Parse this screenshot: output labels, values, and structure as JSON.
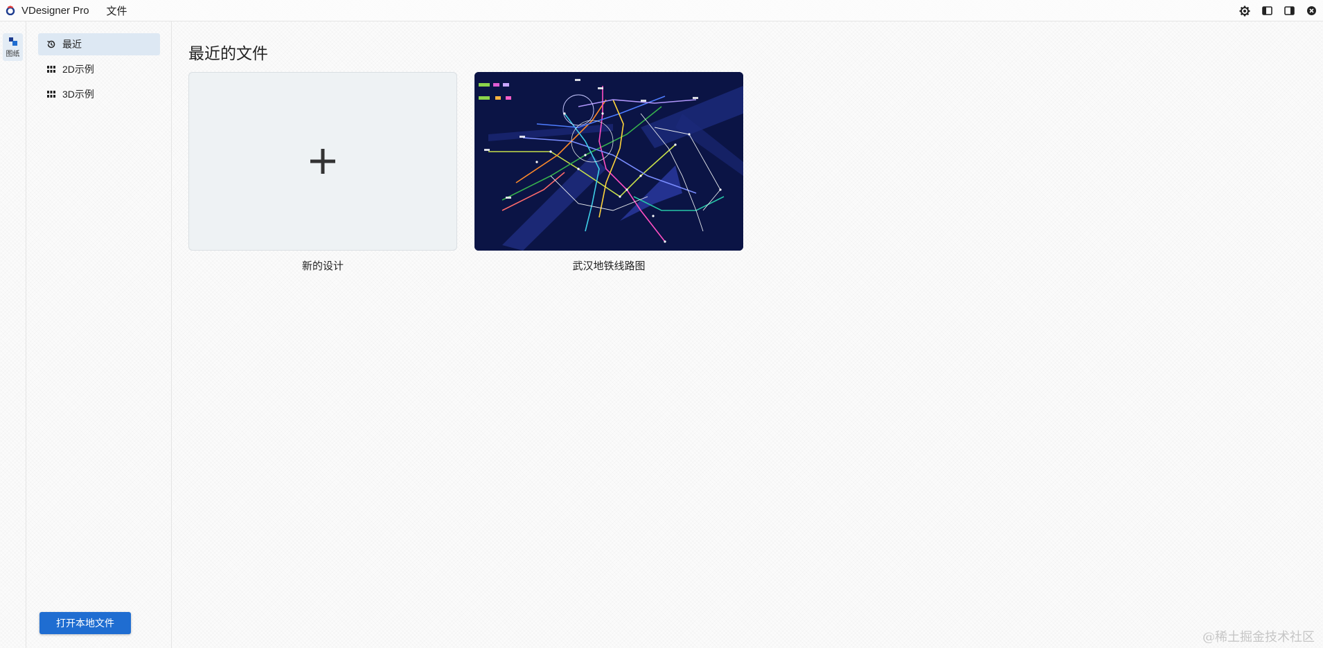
{
  "titlebar": {
    "app_title": "VDesigner Pro",
    "menu_file": "文件",
    "icons": [
      "gear-icon",
      "panel-left-icon",
      "panel-right-icon",
      "close-icon"
    ]
  },
  "activitybar": {
    "items": [
      {
        "label": "图纸",
        "icon": "shapes-icon"
      }
    ]
  },
  "sidebar": {
    "items": [
      {
        "label": "最近",
        "icon": "history-icon",
        "active": true
      },
      {
        "label": "2D示例",
        "icon": "grid-icon",
        "active": false
      },
      {
        "label": "3D示例",
        "icon": "grid-icon",
        "active": false
      }
    ],
    "open_button": "打开本地文件"
  },
  "main": {
    "title": "最近的文件",
    "cards": [
      {
        "label": "新的设计",
        "icon": "plus-icon"
      },
      {
        "label": "武汉地铁线路图",
        "icon": "metro-map-thumbnail"
      }
    ]
  },
  "watermark": "@稀土掘金技术社区",
  "colors": {
    "accent": "#1f6dd1",
    "active_bg": "#dde8f3",
    "map_bg": "#0b1445"
  }
}
